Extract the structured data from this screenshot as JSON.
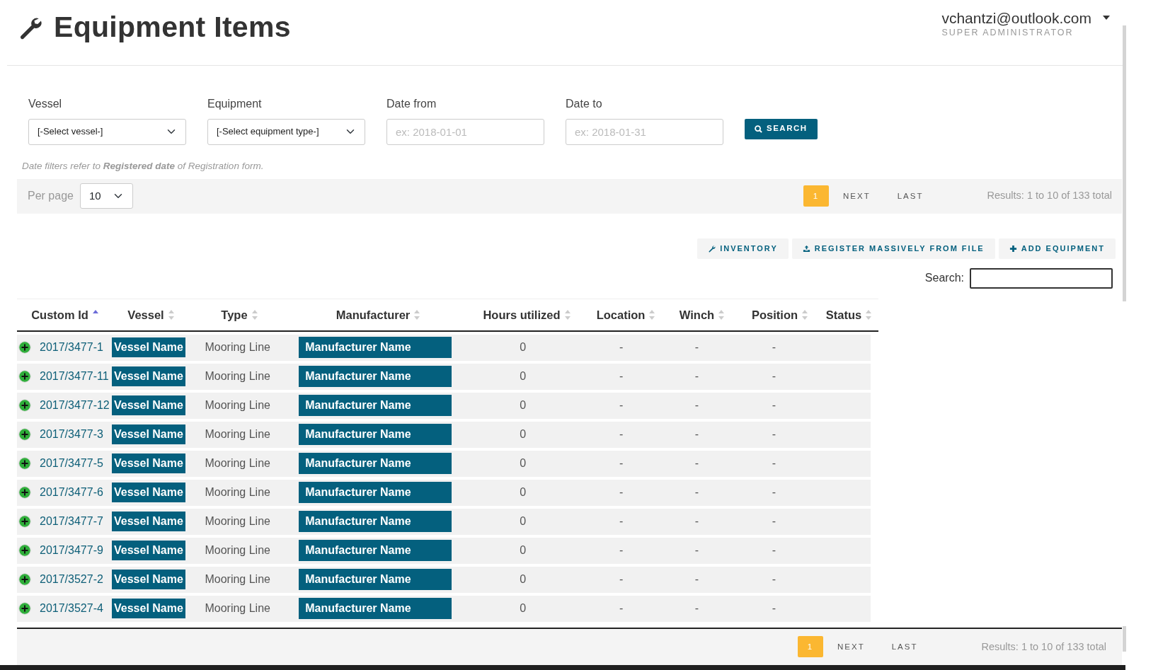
{
  "header": {
    "title": "Equipment Items",
    "user": {
      "email": "vchantzi@outlook.com",
      "role": "SUPER ADMINISTRATOR"
    }
  },
  "filters": [
    {
      "kind": "select",
      "label": "Vessel",
      "value": "[-Select vessel-]"
    },
    {
      "kind": "select",
      "label": "Equipment",
      "value": "[-Select equipment type-]"
    },
    {
      "kind": "date",
      "label": "Date from",
      "placeholder": "ex: 2018-01-01"
    },
    {
      "kind": "date",
      "label": "Date to",
      "placeholder": "ex: 2018-01-31"
    }
  ],
  "search_button": "SEARCH",
  "note": "Date filters refer to **Registered date** of Registration form.",
  "top_pager": {
    "per_page_label": "Per page",
    "per_page": "10",
    "pages": [
      {
        "label": "1",
        "selected": true
      },
      {
        "label": "NEXT",
        "selected": false
      },
      {
        "label": "LAST",
        "selected": false
      }
    ],
    "results": "Results: 1 to 10 of 133 total"
  },
  "actions": [
    {
      "kind": "wrench",
      "label": "INVENTORY"
    },
    {
      "kind": "upload",
      "label": "REGISTER MASSIVELY FROM FILE"
    },
    {
      "kind": "plus",
      "label": "ADD EQUIPMENT"
    }
  ],
  "table_search_label": "Search:",
  "table": {
    "columns": [
      {
        "label": "Custom Id",
        "sorted": true
      },
      {
        "label": "Vessel",
        "sorted": false
      },
      {
        "label": "Type",
        "sorted": false
      },
      {
        "label": "Manufacturer",
        "sorted": false
      },
      {
        "label": "Hours utilized",
        "sorted": false
      },
      {
        "label": "Location",
        "sorted": false
      },
      {
        "label": "Winch",
        "sorted": false
      },
      {
        "label": "Position",
        "sorted": false
      },
      {
        "label": "Status",
        "sorted": false
      }
    ],
    "rows": [
      {
        "custom_id": "2017/3477-1",
        "vessel": "Vessel Name",
        "type": "Mooring Line",
        "manufacturer": "Manufacturer Name",
        "hours": "0",
        "location": "-",
        "winch": "-",
        "position": "-"
      },
      {
        "custom_id": "2017/3477-11",
        "vessel": "Vessel Name",
        "type": "Mooring Line",
        "manufacturer": "Manufacturer Name",
        "hours": "0",
        "location": "-",
        "winch": "-",
        "position": "-"
      },
      {
        "custom_id": "2017/3477-12",
        "vessel": "Vessel Name",
        "type": "Mooring Line",
        "manufacturer": "Manufacturer Name",
        "hours": "0",
        "location": "-",
        "winch": "-",
        "position": "-"
      },
      {
        "custom_id": "2017/3477-3",
        "vessel": "Vessel Name",
        "type": "Mooring Line",
        "manufacturer": "Manufacturer Name",
        "hours": "0",
        "location": "-",
        "winch": "-",
        "position": "-"
      },
      {
        "custom_id": "2017/3477-5",
        "vessel": "Vessel Name",
        "type": "Mooring Line",
        "manufacturer": "Manufacturer Name",
        "hours": "0",
        "location": "-",
        "winch": "-",
        "position": "-"
      },
      {
        "custom_id": "2017/3477-6",
        "vessel": "Vessel Name",
        "type": "Mooring Line",
        "manufacturer": "Manufacturer Name",
        "hours": "0",
        "location": "-",
        "winch": "-",
        "position": "-"
      },
      {
        "custom_id": "2017/3477-7",
        "vessel": "Vessel Name",
        "type": "Mooring Line",
        "manufacturer": "Manufacturer Name",
        "hours": "0",
        "location": "-",
        "winch": "-",
        "position": "-"
      },
      {
        "custom_id": "2017/3477-9",
        "vessel": "Vessel Name",
        "type": "Mooring Line",
        "manufacturer": "Manufacturer Name",
        "hours": "0",
        "location": "-",
        "winch": "-",
        "position": "-"
      },
      {
        "custom_id": "2017/3527-2",
        "vessel": "Vessel Name",
        "type": "Mooring Line",
        "manufacturer": "Manufacturer Name",
        "hours": "0",
        "location": "-",
        "winch": "-",
        "position": "-"
      },
      {
        "custom_id": "2017/3527-4",
        "vessel": "Vessel Name",
        "type": "Mooring Line",
        "manufacturer": "Manufacturer Name",
        "hours": "0",
        "location": "-",
        "winch": "-",
        "position": "-"
      }
    ]
  },
  "bottom_pager": {
    "pages": [
      {
        "label": "1",
        "selected": true
      },
      {
        "label": "NEXT",
        "selected": false
      },
      {
        "label": "LAST",
        "selected": false
      }
    ],
    "results": "Results: 1 to 10 of 133 total"
  }
}
